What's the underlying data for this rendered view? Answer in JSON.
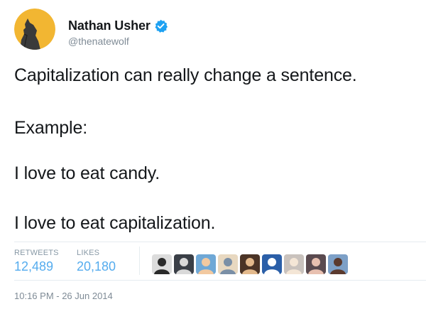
{
  "author": {
    "display_name": "Nathan Usher",
    "handle": "@thenatewolf",
    "verified": true,
    "avatar_icon": "wolf-howling-moon-icon"
  },
  "tweet": {
    "lines": [
      "Capitalization can really change a sentence.",
      "Example:",
      "I love to eat candy.",
      "I love to eat capitalization."
    ]
  },
  "stats": {
    "retweets_label": "RETWEETS",
    "retweets_value": "12,489",
    "likes_label": "LIKES",
    "likes_value": "20,180"
  },
  "likers": [
    {
      "name": "liker-avatar-1",
      "bg": "#dcdcdc",
      "fg": "#2a2a2a"
    },
    {
      "name": "liker-avatar-2",
      "bg": "#3a3f47",
      "fg": "#d9d9d9"
    },
    {
      "name": "liker-avatar-3",
      "bg": "#6fa8d6",
      "fg": "#f2c9a0"
    },
    {
      "name": "liker-avatar-4",
      "bg": "#e8d8c0",
      "fg": "#7a8fa6"
    },
    {
      "name": "liker-avatar-5",
      "bg": "#4b3426",
      "fg": "#e3b98c"
    },
    {
      "name": "liker-avatar-6",
      "bg": "#2b5fa8",
      "fg": "#ffffff"
    },
    {
      "name": "liker-avatar-7",
      "bg": "#c9c2bd",
      "fg": "#f4e6d6"
    },
    {
      "name": "liker-avatar-8",
      "bg": "#5a4a4f",
      "fg": "#e8c0b0"
    },
    {
      "name": "liker-avatar-9",
      "bg": "#7da0c7",
      "fg": "#5b3a2e"
    }
  ],
  "timestamp": "10:16 PM - 26 Jun 2014",
  "colors": {
    "link_blue": "#55acee",
    "verified_blue": "#1da1f2",
    "secondary_text": "#7f8b96",
    "avatar_moon": "#f2b632"
  }
}
